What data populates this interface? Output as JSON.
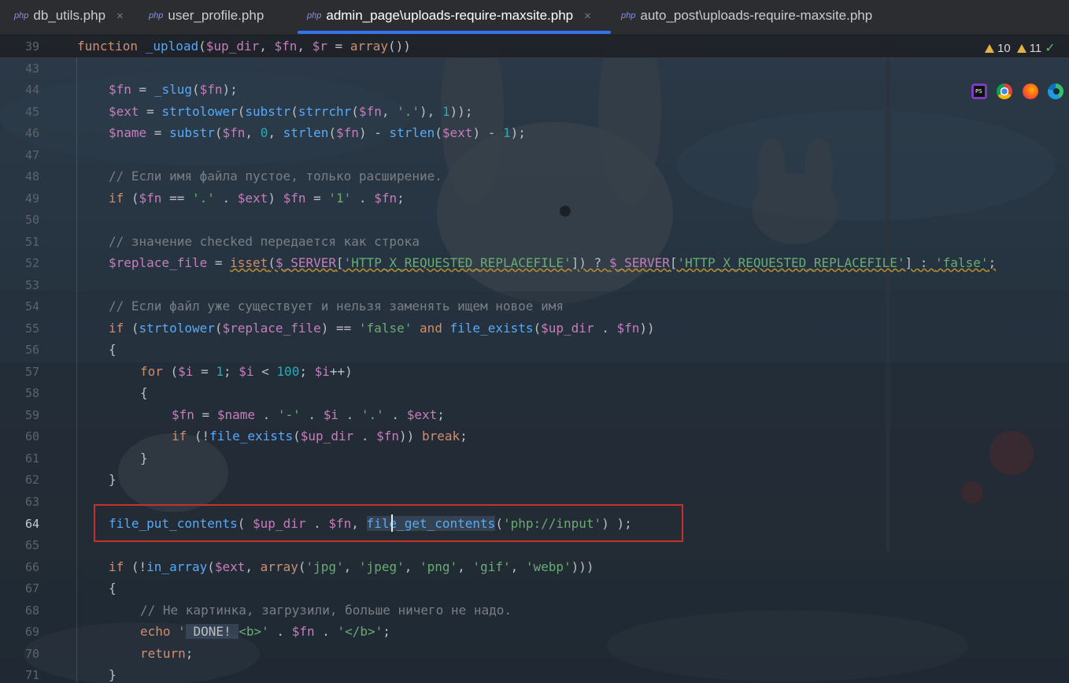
{
  "tabs": [
    {
      "icon": "php",
      "label": "db_utils.php",
      "active": false,
      "closable": true
    },
    {
      "icon": "php",
      "label": "user_profile.php",
      "active": false,
      "closable": false
    },
    {
      "icon": "php",
      "label": "admin_page\\uploads-require-maxsite.php",
      "active": true,
      "closable": true
    },
    {
      "icon": "php",
      "label": "auto_post\\uploads-require-maxsite.php",
      "active": false,
      "closable": false
    }
  ],
  "tab_close_glyph": "×",
  "inspections": {
    "warnings_a": "10",
    "warnings_b": "11",
    "status_icon": "check-icon"
  },
  "browser_icons": [
    "phpstorm-icon",
    "chrome-icon",
    "firefox-icon",
    "edge-icon"
  ],
  "sticky_line": {
    "number": "39",
    "text": "function _upload($up_dir, $fn, $r = array())"
  },
  "current_line": "64",
  "lines": [
    {
      "n": "43",
      "text": ""
    },
    {
      "n": "44",
      "text": "$fn = _slug($fn);"
    },
    {
      "n": "45",
      "text": "$ext = strtolower(substr(strrchr($fn, '.'), 1));"
    },
    {
      "n": "46",
      "text": "$name = substr($fn, 0, strlen($fn) - strlen($ext) - 1);"
    },
    {
      "n": "47",
      "text": ""
    },
    {
      "n": "48",
      "text": "// Если имя файла пустое, только расширение."
    },
    {
      "n": "49",
      "text": "if ($fn == '.' . $ext) $fn = '1' . $fn;"
    },
    {
      "n": "50",
      "text": ""
    },
    {
      "n": "51",
      "text": "// значение checked передается как строка"
    },
    {
      "n": "52",
      "text": "$replace_file = isset($_SERVER['HTTP_X_REQUESTED_REPLACEFILE']) ? $_SERVER['HTTP_X_REQUESTED_REPLACEFILE'] : 'false';"
    },
    {
      "n": "53",
      "text": ""
    },
    {
      "n": "54",
      "text": "// Если файл уже существует и нельзя заменять ищем новое имя"
    },
    {
      "n": "55",
      "text": "if (strtolower($replace_file) == 'false' and file_exists($up_dir . $fn))"
    },
    {
      "n": "56",
      "text": "{"
    },
    {
      "n": "57",
      "text": "for ($i = 1; $i < 100; $i++)"
    },
    {
      "n": "58",
      "text": "{"
    },
    {
      "n": "59",
      "text": "$fn = $name . '-' . $i . '.' . $ext;"
    },
    {
      "n": "60",
      "text": "if (!file_exists($up_dir . $fn)) break;"
    },
    {
      "n": "61",
      "text": "}"
    },
    {
      "n": "62",
      "text": "}"
    },
    {
      "n": "63",
      "text": ""
    },
    {
      "n": "64",
      "text": "file_put_contents( $up_dir . $fn, file_get_contents('php://input') );"
    },
    {
      "n": "65",
      "text": ""
    },
    {
      "n": "66",
      "text": "if (!in_array($ext, array('jpg', 'jpeg', 'png', 'gif', 'webp')))"
    },
    {
      "n": "67",
      "text": "{"
    },
    {
      "n": "68",
      "text": "// Не картинка, загрузили, больше ничего не надо."
    },
    {
      "n": "69",
      "text": "echo ' DONE! <b>' . $fn . '</b>';"
    },
    {
      "n": "70",
      "text": "return;"
    },
    {
      "n": "71",
      "text": "}"
    }
  ],
  "colors": {
    "keyword": "#cf8e6d",
    "function": "#56a8f5",
    "variable": "#c77dbb",
    "string": "#6aab73",
    "number": "#2aacb8",
    "comment": "#7a7e85",
    "highlight_box": "#c9302c",
    "tab_active_underline": "#3574f0",
    "warning": "#e0b248"
  }
}
